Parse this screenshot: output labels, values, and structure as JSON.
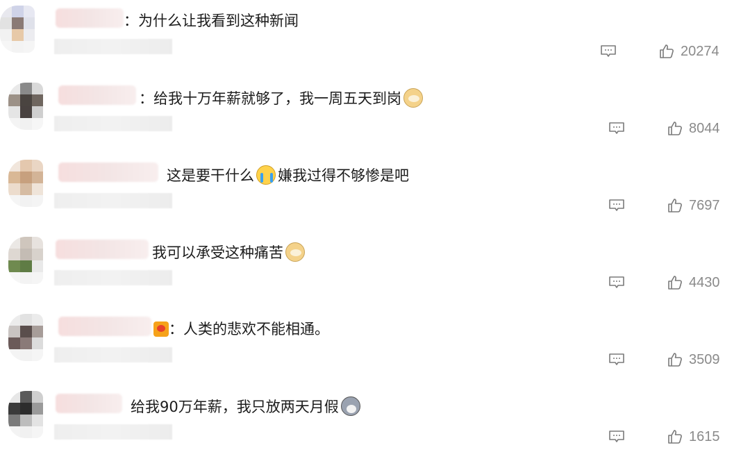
{
  "comments": [
    {
      "text": "：为什么让我看到这种新闻",
      "emoji": "",
      "likes": "20274"
    },
    {
      "text": "：给我十万年薪就够了，我一周五天到岗",
      "emoji": "doge",
      "likes": "8044"
    },
    {
      "text": "这是要干什么",
      "emoji": "cry",
      "text2": "嫌我过得不够惨是吧",
      "likes": "7697"
    },
    {
      "text": "我可以承受这种痛苦",
      "emoji": "doge",
      "likes": "4430"
    },
    {
      "text": "：人类的悲欢不能相通。",
      "emoji": "love",
      "likes": "3509"
    },
    {
      "text": "给我90万年薪，我只放两天月假",
      "emoji": "husky",
      "likes": "1615"
    }
  ],
  "icons": {
    "reply": "comment-reply-icon",
    "like": "thumbs-up-icon"
  },
  "colors": {
    "count": "#8a8a8a",
    "icon": "#7a7a7a"
  }
}
